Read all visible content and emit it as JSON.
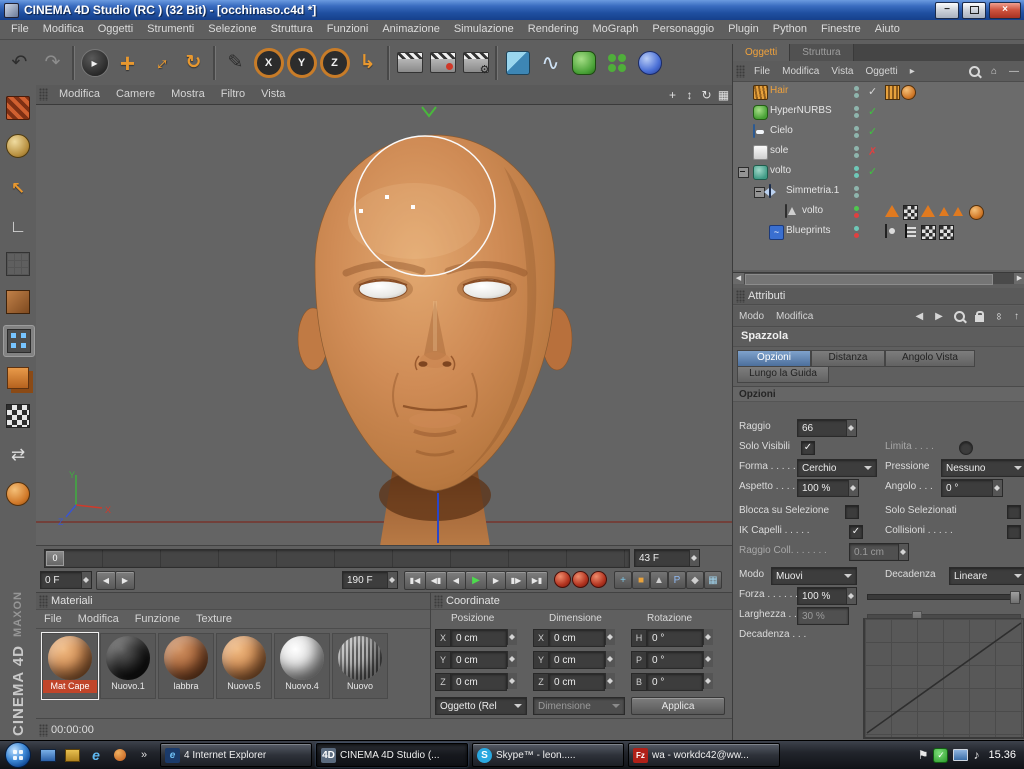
{
  "window": {
    "title": "CINEMA 4D Studio (RC ) (32 Bit) - [occhinaso.c4d *]"
  },
  "menubar": {
    "items": [
      "File",
      "Modifica",
      "Oggetti",
      "Strumenti",
      "Selezione",
      "Struttura",
      "Funzioni",
      "Animazione",
      "Simulazione",
      "Rendering",
      "MoGraph",
      "Personaggio",
      "Plugin",
      "Python",
      "Finestre",
      "Aiuto"
    ]
  },
  "icons": {
    "undo": "↶",
    "redo": "↷",
    "cursor": "▸",
    "move": "+",
    "scale": "↔",
    "rotate": "↻",
    "sketch": "✎",
    "x": "X",
    "y": "Y",
    "z": "Z",
    "coords": "↳",
    "gear": "⚙",
    "spline": "∿",
    "pan": "+",
    "zoom": "↕",
    "orbit": "↻",
    "grid": "▦",
    "home": "⌂",
    "minus": "—",
    "back": "◀",
    "fwd": "▶",
    "link": "∞",
    "up": "↑",
    "overflow": "▸",
    "go_start": "▮◀",
    "prev_key": "◀▮",
    "prev_frame": "◀",
    "play": "▶",
    "next_frame": "▶",
    "next_key": "▮▶",
    "go_end": "▶▮",
    "key_pos": "+",
    "key_box": "■",
    "key_tri": "▲",
    "key_p": "P",
    "key_d": "◆",
    "key_grid": "▦",
    "chevron": "»",
    "ie": "e",
    "skype": "S",
    "fz": "Fz",
    "c4d": "4D",
    "flag": "⚑",
    "note": "♪",
    "min": "−",
    "close": "×",
    "make_editable": "↖",
    "axis": "∟",
    "snap": "⇄"
  },
  "viewport": {
    "menu": [
      "Modifica",
      "Camere",
      "Mostra",
      "Filtro",
      "Vista"
    ]
  },
  "branding": {
    "line1": "MAXON",
    "line2": "CINEMA 4D"
  },
  "timeline": {
    "current": "0",
    "marker_end": "43 F",
    "start_field": "0 F",
    "end_field": "190 F"
  },
  "materials": {
    "title": "Materiali",
    "menu": [
      "File",
      "Modifica",
      "Funzione",
      "Texture"
    ],
    "items": [
      {
        "name": "Mat Cape"
      },
      {
        "name": "Nuovo.1"
      },
      {
        "name": "labbra"
      },
      {
        "name": "Nuovo.5"
      },
      {
        "name": "Nuovo.4"
      },
      {
        "name": "Nuovo"
      }
    ]
  },
  "coordinates": {
    "title": "Coordinate",
    "headers": [
      "Posizione",
      "Dimensione",
      "Rotazione"
    ],
    "labels": {
      "x": "X",
      "y": "Y",
      "z": "Z",
      "h": "H",
      "p": "P",
      "b": "B"
    },
    "values": {
      "px": "0 cm",
      "py": "0 cm",
      "pz": "0 cm",
      "dx": "0 cm",
      "dy": "0 cm",
      "dz": "0 cm",
      "rh": "0 °",
      "rp": "0 °",
      "rb": "0 °"
    },
    "object_mode": "Oggetto (Rel",
    "dimension_mode": "Dimensione",
    "apply": "Applica"
  },
  "status": {
    "timecode": "00:00:00"
  },
  "objects": {
    "tabs": [
      "Oggetti",
      "Struttura"
    ],
    "menu": [
      "File",
      "Modifica",
      "Vista",
      "Oggetti"
    ],
    "tree": [
      {
        "label": "Hair"
      },
      {
        "label": "HyperNURBS"
      },
      {
        "label": "Cielo"
      },
      {
        "label": "sole"
      },
      {
        "label": "volto"
      },
      {
        "label": "Simmetria.1"
      },
      {
        "label": "volto"
      },
      {
        "label": "Blueprints"
      }
    ]
  },
  "attributes": {
    "title": "Attributi",
    "menu": [
      "Modo",
      "Modifica"
    ],
    "tool": "Spazzola",
    "tabs": [
      "Opzioni",
      "Distanza",
      "Angolo Vista",
      "Lungo la Guida"
    ],
    "section": "Opzioni",
    "rows": {
      "raggio": {
        "label": "Raggio",
        "value": "66"
      },
      "solo_visibili": {
        "label": "Solo Visibili"
      },
      "limita": {
        "label": "Limita . . . ."
      },
      "forma": {
        "label": "Forma . . . . .",
        "value": "Cerchio"
      },
      "pressione": {
        "label": "Pressione",
        "value": "Nessuno"
      },
      "aspetto": {
        "label": "Aspetto . . . .",
        "value": "100 %"
      },
      "angolo": {
        "label": "Angolo . . .",
        "value": "0 °"
      },
      "blocca": {
        "label": "Blocca su Selezione"
      },
      "solo_selezionati": {
        "label": "Solo Selezionati"
      },
      "ik_capelli": {
        "label": "IK Capelli . . . . ."
      },
      "collisioni": {
        "label": "Collisioni . . . . ."
      },
      "raggio_coll": {
        "label": "Raggio Coll. . . . . . .",
        "value": "0.1 cm"
      },
      "modo": {
        "label": "Modo",
        "value": "Muovi"
      },
      "decadenza_dd": {
        "label": "Decadenza",
        "value": "Lineare"
      },
      "forza": {
        "label": "Forza . . . . . .",
        "value": "100 %"
      },
      "larghezza": {
        "label": "Larghezza . . .",
        "value": "30 %"
      },
      "decadenza": {
        "label": "Decadenza . . ."
      }
    }
  },
  "taskbar": {
    "tasks": [
      {
        "label": "4 Internet Explorer"
      },
      {
        "label": "CINEMA 4D Studio (..."
      },
      {
        "label": "Skype™ - leon....."
      },
      {
        "label": "wa - workdc42@ww..."
      }
    ],
    "clock": "15.36"
  }
}
